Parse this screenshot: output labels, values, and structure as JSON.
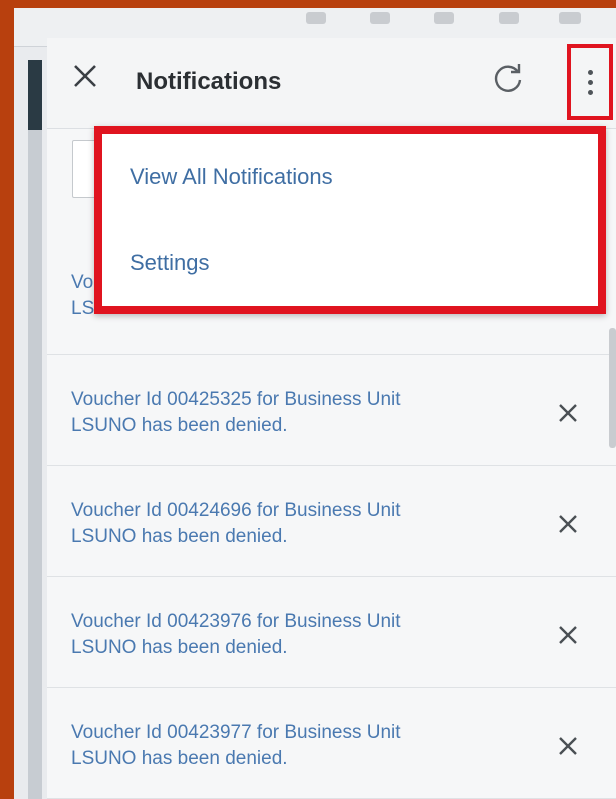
{
  "header": {
    "title": "Notifications"
  },
  "menu": {
    "items": [
      {
        "label": "View All Notifications"
      },
      {
        "label": "Settings"
      }
    ]
  },
  "notifications": [
    {
      "text_partial": "Vo",
      "text_line2": "LSUNO has been denied."
    },
    {
      "line1": "Voucher Id 00425325 for Business Unit",
      "line2": "LSUNO has been denied."
    },
    {
      "line1": "Voucher Id 00424696 for Business Unit",
      "line2": "LSUNO has been denied."
    },
    {
      "line1": "Voucher Id 00423976 for Business Unit",
      "line2": "LSUNO has been denied."
    },
    {
      "line1": "Voucher Id 00423977 for Business Unit",
      "line2": "LSUNO has been denied."
    }
  ],
  "icons": {
    "close": "close-icon",
    "refresh": "refresh-icon",
    "more": "kebab-menu-icon",
    "dismiss": "dismiss-icon"
  },
  "colors": {
    "highlight": "#e0141f",
    "link": "#4a79b0",
    "background": "#b8400e"
  }
}
